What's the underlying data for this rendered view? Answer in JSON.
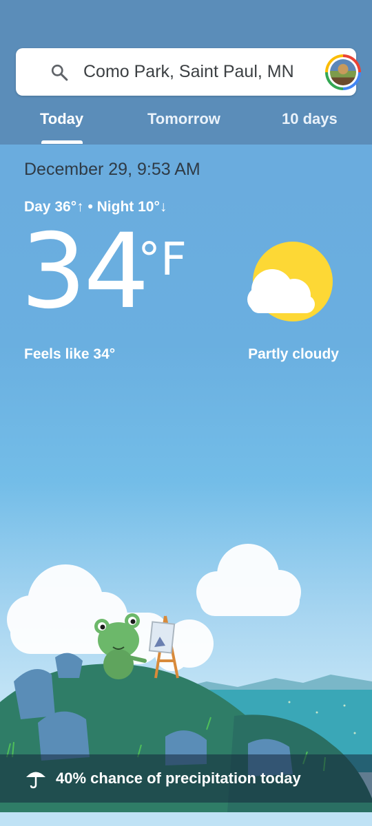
{
  "search": {
    "location": "Como Park, Saint Paul, MN"
  },
  "tabs": {
    "today": "Today",
    "tomorrow": "Tomorrow",
    "ten_days": "10 days"
  },
  "current": {
    "datetime": "December 29, 9:53 AM",
    "day_night": "Day 36°↑ • Night 10°↓",
    "temperature": "34",
    "unit": "°F",
    "feels_like": "Feels like 34°",
    "condition": "Partly cloudy"
  },
  "precipitation": {
    "text": "40% chance of precipitation today"
  },
  "icons": {
    "search": "search-icon",
    "avatar": "account-avatar",
    "weather": "partly-cloudy-icon",
    "umbrella": "umbrella-icon"
  },
  "colors": {
    "header": "#5b8db9",
    "sky": "#6aafe0",
    "sun": "#fdd835"
  }
}
